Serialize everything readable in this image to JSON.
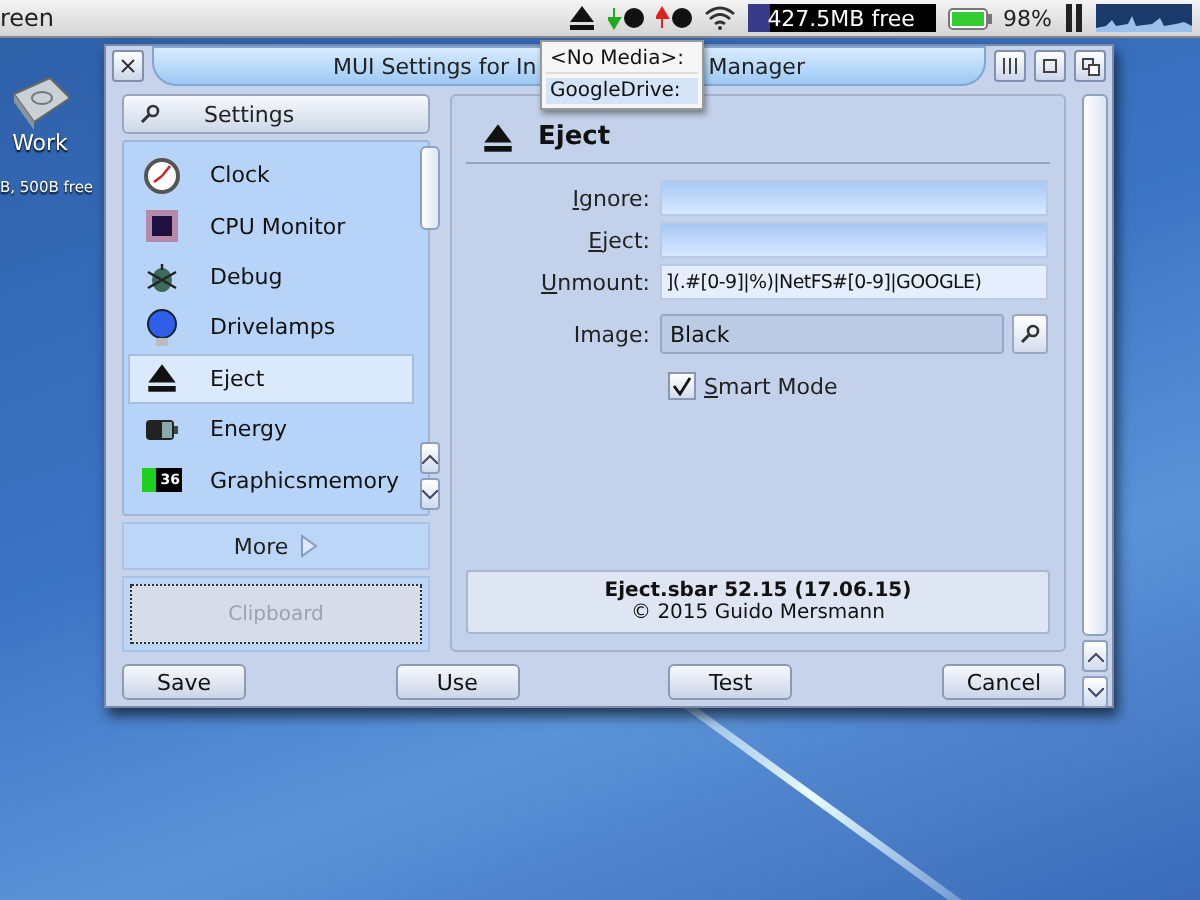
{
  "screen_title": "reen",
  "menubar": {
    "disk_free": {
      "text": "427.5MB free",
      "level": 0.12
    },
    "battery": "98%"
  },
  "drive_menu": {
    "items": [
      {
        "label": "<No Media>:",
        "selected": false
      },
      {
        "label": "GoogleDrive:",
        "selected": true
      }
    ]
  },
  "desktop_icons": [
    {
      "label": "Work",
      "info": "B, 500B free"
    }
  ],
  "window": {
    "title_left": "MUI Settings for In",
    "title_right": "Manager"
  },
  "sidebar": {
    "search_button": "Settings",
    "items": [
      {
        "label": "Clock",
        "selected": false
      },
      {
        "label": "CPU Monitor",
        "selected": false
      },
      {
        "label": "Debug",
        "selected": false
      },
      {
        "label": "Drivelamps",
        "selected": false
      },
      {
        "label": "Eject",
        "selected": true
      },
      {
        "label": "Energy",
        "selected": false
      },
      {
        "label": "Graphicsmemory",
        "selected": false
      }
    ],
    "graphics_badge": "36",
    "more_button": "More",
    "clipboard_button": {
      "label": "Clipboard",
      "disabled": true
    }
  },
  "panel": {
    "title": "Eject",
    "fields": [
      {
        "label": "Ignore:",
        "mnemonic": true
      },
      {
        "label": "Eject:",
        "mnemonic": true
      },
      {
        "label": "Unmount:",
        "mnemonic": true,
        "value": "](.#[0-9]|%)|NetFS#[0-9]|GOOGLE)"
      }
    ],
    "image": {
      "label": "Image:",
      "value": "Black"
    },
    "smart_mode": {
      "label": "Smart Mode",
      "checked": true
    },
    "info": {
      "title": "Eject.sbar 52.15 (17.06.15)",
      "copyright": "© 2015 Guido Mersmann"
    }
  },
  "buttons": [
    "Save",
    "Use",
    "Test",
    "Cancel"
  ]
}
